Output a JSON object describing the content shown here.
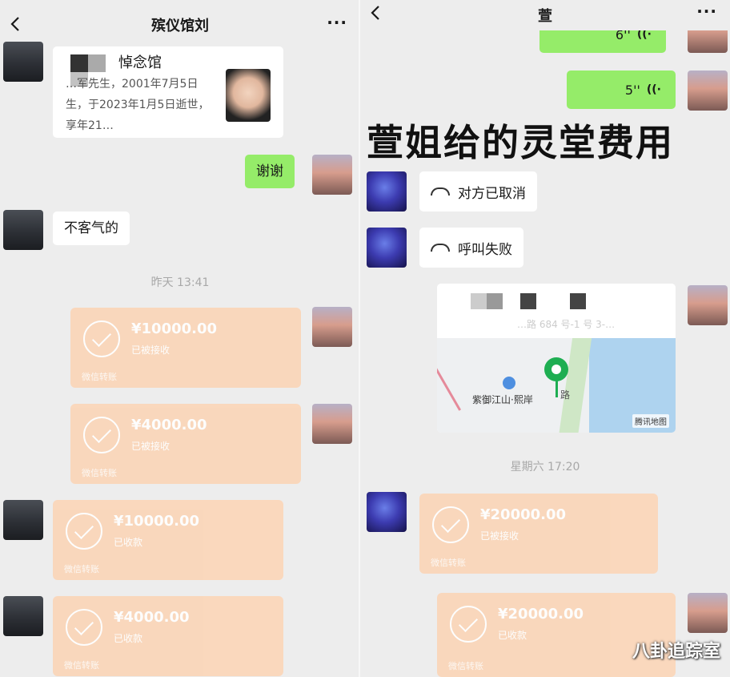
{
  "left_chat": {
    "title": "殡仪馆刘",
    "more": "···",
    "memorial": {
      "title": "悼念馆",
      "desc": "…军先生，2001年7月5日生，于2023年1月5日逝世，享年21…"
    },
    "thanks": "谢谢",
    "welcome": "不客气的",
    "time": "昨天 13:41",
    "transfers": [
      {
        "amount": "¥10000.00",
        "status": "已被接收",
        "footer": "微信转账"
      },
      {
        "amount": "¥4000.00",
        "status": "已被接收",
        "footer": "微信转账"
      },
      {
        "amount": "¥10000.00",
        "status": "已收款",
        "footer": "微信转账"
      },
      {
        "amount": "¥4000.00",
        "status": "已收款",
        "footer": "微信转账"
      }
    ]
  },
  "right_chat": {
    "title": "萱",
    "more": "···",
    "voice_top": "6''",
    "voice": "5''",
    "overlay": "萱姐给的灵堂费用",
    "call_cancelled": "对方已取消",
    "call_failed": "呼叫失败",
    "location": {
      "poi": "紫御江山·熙岸",
      "road": "路",
      "address": "…路 684 号-1 号 3-…",
      "map_source": "腾讯地图"
    },
    "time": "星期六 17:20",
    "transfers": [
      {
        "amount": "¥20000.00",
        "status": "已被接收",
        "footer": "微信转账"
      },
      {
        "amount": "¥20000.00",
        "status": "已收款",
        "footer": "微信转账"
      }
    ]
  },
  "watermark": "八卦追踪室"
}
